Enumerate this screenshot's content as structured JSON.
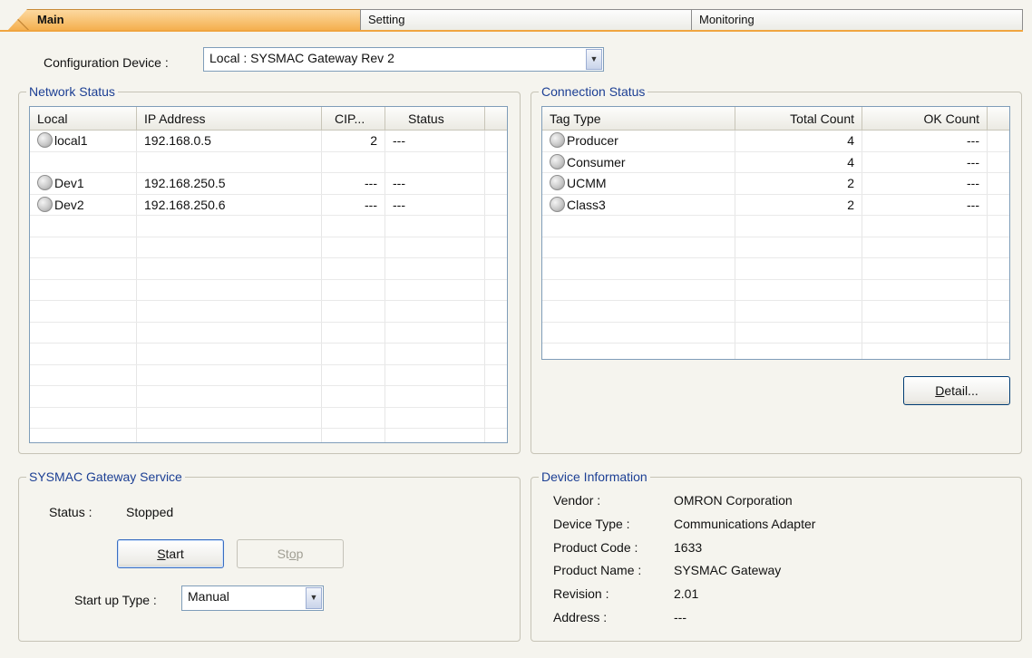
{
  "tabs": [
    {
      "label": "Main",
      "active": true
    },
    {
      "label": "Setting",
      "active": false
    },
    {
      "label": "Monitoring",
      "active": false
    }
  ],
  "config_device": {
    "label": "Configuration Device :",
    "value": "Local : SYSMAC Gateway Rev 2"
  },
  "network_status": {
    "title": "Network Status",
    "columns": [
      "Local",
      "IP Address",
      "CIP...",
      "Status"
    ],
    "rows": [
      {
        "name": "local1",
        "ip": "192.168.0.5",
        "cip": "2",
        "status": "---",
        "led": true
      },
      {
        "name": "",
        "ip": "",
        "cip": "",
        "status": "",
        "led": false
      },
      {
        "name": "Dev1",
        "ip": "192.168.250.5",
        "cip": "---",
        "status": "---",
        "led": true
      },
      {
        "name": "Dev2",
        "ip": "192.168.250.6",
        "cip": "---",
        "status": "---",
        "led": true
      }
    ]
  },
  "connection_status": {
    "title": "Connection Status",
    "columns": [
      "Tag Type",
      "Total Count",
      "OK Count"
    ],
    "rows": [
      {
        "tag": "Producer",
        "total": "4",
        "ok": "---"
      },
      {
        "tag": "Consumer",
        "total": "4",
        "ok": "---"
      },
      {
        "tag": "UCMM",
        "total": "2",
        "ok": "---"
      },
      {
        "tag": "Class3",
        "total": "2",
        "ok": "---"
      }
    ],
    "detail_button": {
      "mnemonic": "D",
      "rest": "etail..."
    }
  },
  "gateway_service": {
    "title": "SYSMAC Gateway Service",
    "status_label": "Status :",
    "status_value": "Stopped",
    "start_button": {
      "mnemonic": "S",
      "rest": "tart"
    },
    "stop_button": {
      "pre": "St",
      "mnemonic": "o",
      "rest": "p"
    },
    "startup_label": "Start up Type :",
    "startup_value": "Manual"
  },
  "device_info": {
    "title": "Device Information",
    "fields": [
      {
        "label": "Vendor :",
        "value": "OMRON Corporation"
      },
      {
        "label": "Device Type :",
        "value": "Communications Adapter"
      },
      {
        "label": "Product Code :",
        "value": "1633"
      },
      {
        "label": "Product Name :",
        "value": "SYSMAC Gateway"
      },
      {
        "label": "Revision :",
        "value": "2.01"
      },
      {
        "label": "Address :",
        "value": "---"
      }
    ]
  }
}
